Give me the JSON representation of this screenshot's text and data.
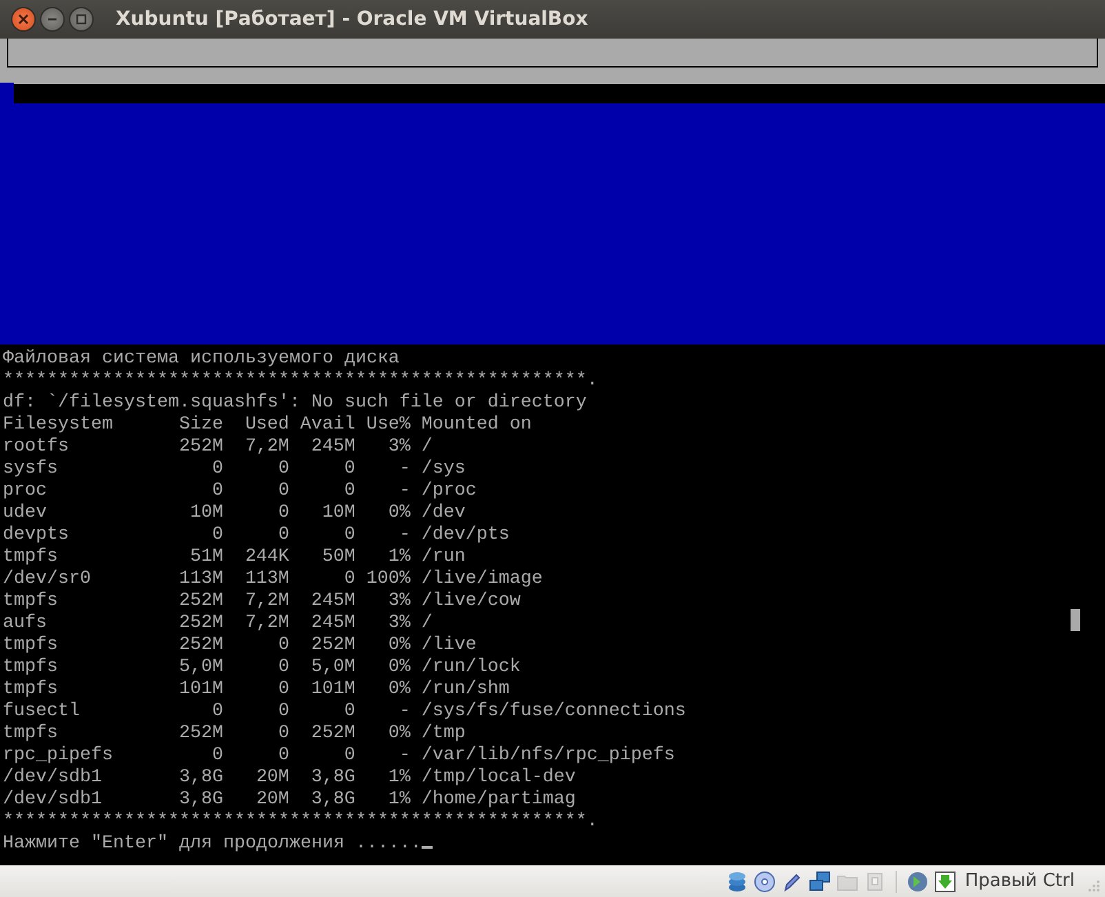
{
  "window": {
    "title": "Xubuntu [Работает] - Oracle VM VirtualBox",
    "buttons": [
      {
        "kind": "close"
      },
      {
        "kind": "minimize"
      },
      {
        "kind": "maximize"
      }
    ]
  },
  "console": {
    "heading": "Файловая система используемого диска",
    "rule_top": "*****************************************************.",
    "error": "df: `/filesystem.squashfs': No such file or directory",
    "df_table": {
      "columns": [
        "Filesystem",
        "Size",
        "Used",
        "Avail",
        "Use%",
        "Mounted on"
      ],
      "rows": [
        [
          "rootfs",
          "252M",
          "7,2M",
          "245M",
          "3%",
          "/"
        ],
        [
          "sysfs",
          "0",
          "0",
          "0",
          "-",
          "/sys"
        ],
        [
          "proc",
          "0",
          "0",
          "0",
          "-",
          "/proc"
        ],
        [
          "udev",
          "10M",
          "0",
          "10M",
          "0%",
          "/dev"
        ],
        [
          "devpts",
          "0",
          "0",
          "0",
          "-",
          "/dev/pts"
        ],
        [
          "tmpfs",
          "51M",
          "244K",
          "50M",
          "1%",
          "/run"
        ],
        [
          "/dev/sr0",
          "113M",
          "113M",
          "0",
          "100%",
          "/live/image"
        ],
        [
          "tmpfs",
          "252M",
          "7,2M",
          "245M",
          "3%",
          "/live/cow"
        ],
        [
          "aufs",
          "252M",
          "7,2M",
          "245M",
          "3%",
          "/"
        ],
        [
          "tmpfs",
          "252M",
          "0",
          "252M",
          "0%",
          "/live"
        ],
        [
          "tmpfs",
          "5,0M",
          "0",
          "5,0M",
          "0%",
          "/run/lock"
        ],
        [
          "tmpfs",
          "101M",
          "0",
          "101M",
          "0%",
          "/run/shm"
        ],
        [
          "fusectl",
          "0",
          "0",
          "0",
          "-",
          "/sys/fs/fuse/connections"
        ],
        [
          "tmpfs",
          "252M",
          "0",
          "252M",
          "0%",
          "/tmp"
        ],
        [
          "rpc_pipefs",
          "0",
          "0",
          "0",
          "-",
          "/var/lib/nfs/rpc_pipefs"
        ],
        [
          "/dev/sdb1",
          "3,8G",
          "20M",
          "3,8G",
          "1%",
          "/tmp/local-dev"
        ],
        [
          "/dev/sdb1",
          "3,8G",
          "20M",
          "3,8G",
          "1%",
          "/home/partimag"
        ]
      ]
    },
    "rule_bottom": "*****************************************************.",
    "prompt": "Нажмите \"Enter\" для продолжения ......"
  },
  "status_bar": {
    "indicators": [
      {
        "kind": "disk",
        "disabled": false
      },
      {
        "kind": "optical",
        "disabled": false
      },
      {
        "kind": "usb",
        "disabled": false
      },
      {
        "kind": "network",
        "disabled": false
      },
      {
        "kind": "folder",
        "disabled": true
      },
      {
        "kind": "chip",
        "disabled": true
      },
      {
        "kind": "separator"
      },
      {
        "kind": "globe",
        "disabled": false
      },
      {
        "kind": "capture",
        "disabled": false
      }
    ],
    "host_key": "Правый Ctrl"
  }
}
